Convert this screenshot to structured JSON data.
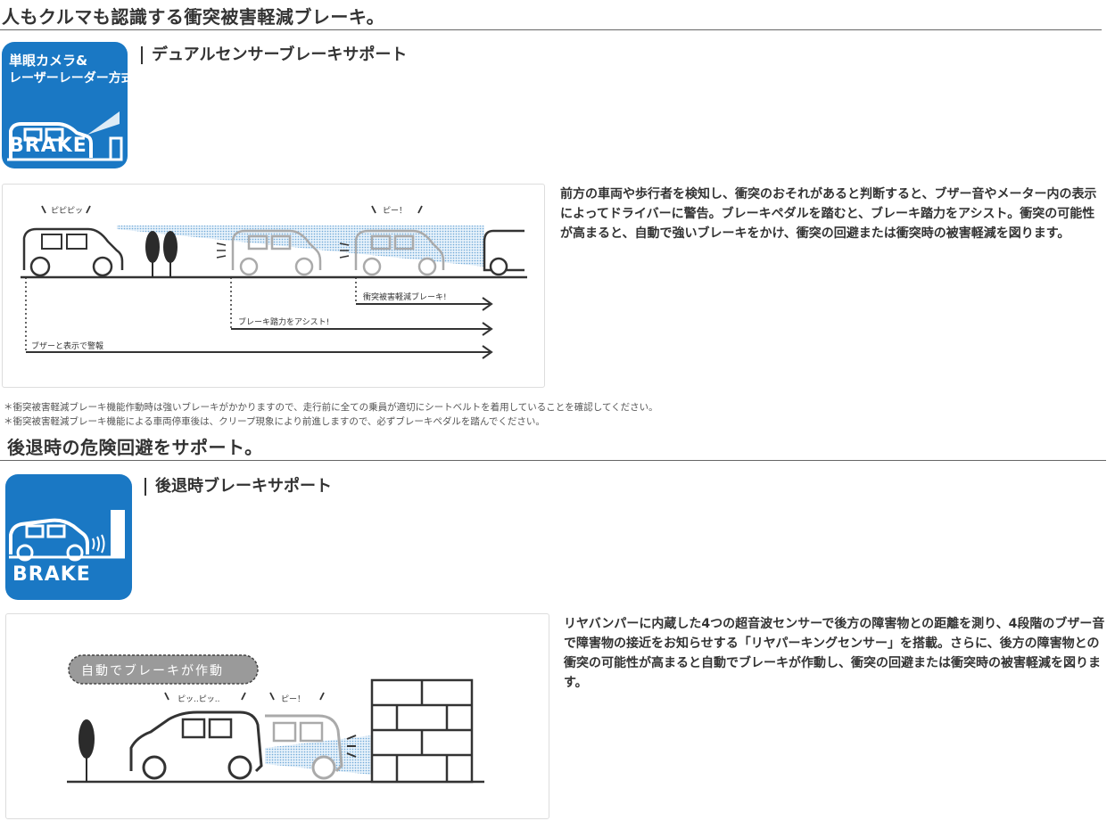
{
  "section1": {
    "heading": "人もクルマも認識する衝突被害軽減ブレーキ。",
    "badge": {
      "line1": "単眼カメラ&",
      "line2": "レーザーレーダー方式",
      "label": "BRAKE",
      "color": "#1a78c4"
    },
    "subtitle": "デュアルセンサーブレーキサポート",
    "diagram": {
      "sound1": "ピピピッ",
      "sound2": "ピー！",
      "arrow1": "衝突被害軽減ブレーキ!",
      "arrow2": "ブレーキ踏力をアシスト!",
      "arrow3": "ブザーと表示で警報"
    },
    "description": "前方の車両や歩行者を検知し、衝突のおそれがあると判断すると、ブザー音やメーター内の表示によってドライバーに警告。ブレーキペダルを踏むと、ブレーキ踏力をアシスト。衝突の可能性が高まると、自動で強いブレーキをかけ、衝突の回避または衝突時の被害軽減を図ります。",
    "notes": [
      "＊衝突被害軽減ブレーキ機能作動時は強いブレーキがかかりますので、走行前に全ての乗員が適切にシートベルトを着用していることを確認してください。",
      "＊衝突被害軽減ブレーキ機能による車両停車後は、クリープ現象により前進しますので、必ずブレーキペダルを踏んでください。"
    ]
  },
  "section2": {
    "heading": "後退時の危険回避をサポート。",
    "badge": {
      "label": "BRAKE",
      "color": "#1a78c4"
    },
    "subtitle": "後退時ブレーキサポート",
    "diagram": {
      "bubble": "自動でブレーキが作動",
      "sound1": "ピッ..ピッ..",
      "sound2": "ピー！"
    },
    "description": "リヤバンパーに内蔵した4つの超音波センサーで後方の障害物との距離を測り、4段階のブザー音で障害物の接近をお知らせする「リヤパーキングセンサー」を搭載。さらに、後方の障害物との衝突の可能性が高まると自動でブレーキが作動し、衝突の回避または衝突時の被害軽減を図ります。"
  }
}
